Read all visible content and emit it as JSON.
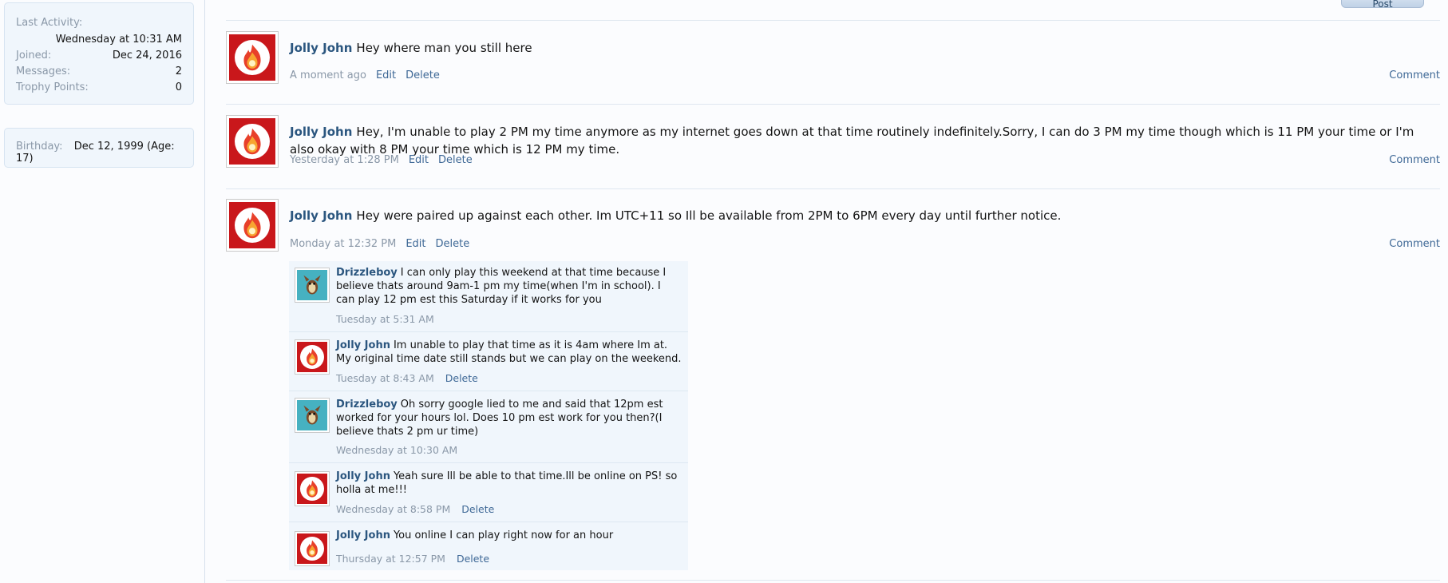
{
  "sidebar": {
    "stats": [
      {
        "label": "Last Activity:",
        "value": ""
      },
      {
        "label": "",
        "value": "Wednesday at 10:31 AM"
      },
      {
        "label": "Joined:",
        "value": "Dec 24, 2016"
      },
      {
        "label": "Messages:",
        "value": "2"
      },
      {
        "label": "Trophy Points:",
        "value": "0"
      }
    ],
    "birthday": {
      "label": "Birthday:",
      "value": "Dec 12, 1999 (Age: 17)"
    }
  },
  "post_button_label": "Post",
  "messages": [
    {
      "user": "Jolly John",
      "text": "Hey where man you still here",
      "time": "A moment ago",
      "edit": "Edit",
      "delete": "Delete",
      "comment": "Comment",
      "avatar_icon": "fire-ball-icon"
    },
    {
      "user": "Jolly John",
      "text": "Hey, I'm unable to play 2 PM my time anymore as my internet goes down at that time routinely indefinitely.Sorry, I can do 3 PM my time though which is 11 PM your time or I'm also okay with 8 PM your time which is 12 PM my time.",
      "time": "Yesterday at 1:28 PM",
      "edit": "Edit",
      "delete": "Delete",
      "comment": "Comment",
      "avatar_icon": "fire-ball-icon"
    },
    {
      "user": "Jolly John",
      "text": "Hey were paired up against each other. Im UTC+11 so Ill be available from 2PM to 6PM every day until further notice.",
      "time": "Monday at 12:32 PM",
      "edit": "Edit",
      "delete": "Delete",
      "comment": "Comment",
      "avatar_icon": "fire-ball-icon"
    }
  ],
  "comments": [
    {
      "user": "Drizzleboy",
      "text": "I can only play this weekend at that time because I believe thats around 9am-1 pm my time(when I'm in school). I can play 12 pm est this Saturday if it works for you",
      "time": "Tuesday at 5:31 AM",
      "delete": "",
      "avatar_icon": "creature-icon"
    },
    {
      "user": "Jolly John",
      "text": "Im unable to play that time as it is 4am where Im at. My original time date still stands but we can play on the weekend.",
      "time": "Tuesday at 8:43 AM",
      "delete": "Delete",
      "avatar_icon": "fire-ball-icon"
    },
    {
      "user": "Drizzleboy",
      "text": "Oh sorry google lied to me and said that 12pm est worked for your hours lol. Does 10 pm est work for you then?(I believe thats 2 pm ur time)",
      "time": "Wednesday at 10:30 AM",
      "delete": "",
      "avatar_icon": "creature-icon"
    },
    {
      "user": "Jolly John",
      "text": "Yeah sure Ill be able to that time.Ill be online on PS! so holla at me!!!",
      "time": "Wednesday at 8:58 PM",
      "delete": "Delete",
      "avatar_icon": "fire-ball-icon"
    },
    {
      "user": "Jolly John",
      "text": "You online I can play right now for an hour",
      "time": "Thursday at 12:57 PM",
      "delete": "Delete",
      "avatar_icon": "fire-ball-icon"
    }
  ],
  "colors": {
    "accent": "#2b567f",
    "link": "#3e6896",
    "muted": "#8a98a8",
    "avatar_red": "#c9171b",
    "avatar_teal": "#46b1c1"
  }
}
